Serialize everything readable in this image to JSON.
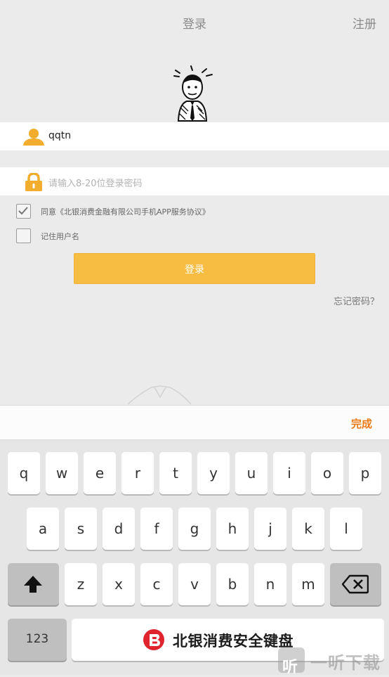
{
  "header": {
    "title": "登录",
    "register_label": "注册"
  },
  "form": {
    "username_value": "qqtn",
    "password_placeholder": "请输入8-20位登录密码",
    "agree_label": "同意《北银消费金融有限公司手机APP服务协议》",
    "agree_checked": true,
    "remember_label": "记住用户名",
    "remember_checked": false,
    "login_label": "登录",
    "forgot_label": "忘记密码？"
  },
  "keyboard": {
    "done_label": "完成",
    "row1": [
      "q",
      "w",
      "e",
      "r",
      "t",
      "y",
      "u",
      "i",
      "o",
      "p"
    ],
    "row2": [
      "a",
      "s",
      "d",
      "f",
      "g",
      "h",
      "j",
      "k",
      "l"
    ],
    "row3": [
      "z",
      "x",
      "c",
      "v",
      "b",
      "n",
      "m"
    ],
    "num_label": "123",
    "brand_label": "北银消费安全键盘"
  },
  "watermark": {
    "text": "一听下载",
    "icon": "听"
  },
  "colors": {
    "accent": "#f7bd43",
    "done": "#ec7a17",
    "icon": "#f2ac2e"
  }
}
